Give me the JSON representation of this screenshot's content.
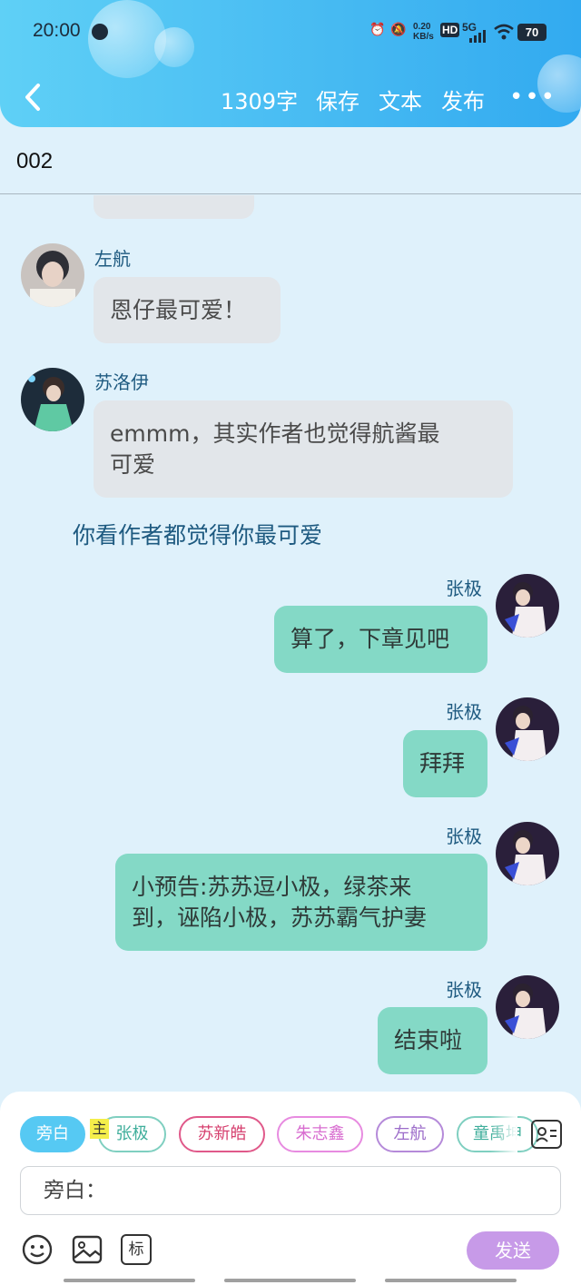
{
  "status_bar": {
    "time": "20:00",
    "net_speed_top": "0.20",
    "net_speed_unit": "KB/s",
    "hd": "HD",
    "signal": "5G",
    "battery": "70"
  },
  "nav": {
    "word_count": "1309字",
    "save": "保存",
    "text": "文本",
    "publish": "发布",
    "more": "•••"
  },
  "chapter_title": "002",
  "messages": [
    {
      "speaker": "左航",
      "text": "恩仔最可爱！"
    },
    {
      "speaker": "苏洛伊",
      "text_line1": "emmm，其实作者也觉得航酱最",
      "text_line2": "可爱"
    },
    {
      "narration": "你看作者都觉得你最可爱"
    },
    {
      "speaker": "张极",
      "text": "算了，下章见吧"
    },
    {
      "speaker": "张极",
      "text": "拜拜"
    },
    {
      "speaker": "张极",
      "text_line1": "小预告:苏苏逗小极，绿茶来",
      "text_line2": "到，诬陷小极，苏苏霸气护妻"
    },
    {
      "speaker": "张极",
      "text": "结束啦"
    }
  ],
  "roles": [
    {
      "label": "旁白",
      "color": "#56c9f3"
    },
    {
      "label": "张极",
      "color": "#7fcfc0"
    },
    {
      "label": "苏新皓",
      "color": "#e0598a"
    },
    {
      "label": "朱志鑫",
      "color": "#e78be0"
    },
    {
      "label": "左航",
      "color": "#b58ad9"
    },
    {
      "label": "童禹坤",
      "color": "#7fcfc0"
    }
  ],
  "host_tag": "主",
  "input_placeholder": "旁白：",
  "toolbar": {
    "emoji": "emoji-icon",
    "image": "image-icon",
    "tag": "标",
    "send": "发送"
  }
}
